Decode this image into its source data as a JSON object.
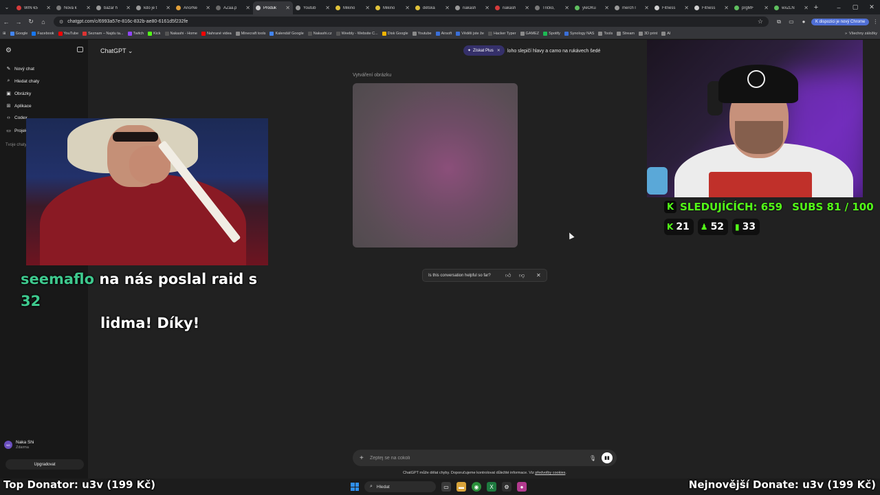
{
  "browser": {
    "tabs": [
      {
        "label": "WIN €5",
        "color": "#d63b3b",
        "active": false
      },
      {
        "label": "Nová k",
        "color": "#7a7a7a",
        "active": false
      },
      {
        "label": "bazar h",
        "color": "#9a9a9a",
        "active": false
      },
      {
        "label": "kdo je t",
        "color": "#9a9a9a",
        "active": false
      },
      {
        "label": "Ano/Ne",
        "color": "#e2a03a",
        "active": false
      },
      {
        "label": "AZaa.p",
        "color": "#6b6b6b",
        "active": false
      },
      {
        "label": "Produk",
        "color": "#cfcfcf",
        "active": true
      },
      {
        "label": "Youtub",
        "color": "#9a9a9a",
        "active": false
      },
      {
        "label": "Mikino",
        "color": "#e0c23a",
        "active": false
      },
      {
        "label": "Mikino",
        "color": "#e0c23a",
        "active": false
      },
      {
        "label": "dětská",
        "color": "#e0c23a",
        "active": false
      },
      {
        "label": "nakash",
        "color": "#9a9a9a",
        "active": false
      },
      {
        "label": "nakash",
        "color": "#d63b3b",
        "active": false
      },
      {
        "label": "Tričko,",
        "color": "#7a7a7a",
        "active": false
      },
      {
        "label": "yleOKu",
        "color": "#5fbf5f",
        "active": false
      },
      {
        "label": "merch l",
        "color": "#9a9a9a",
        "active": false
      },
      {
        "label": "Fitness",
        "color": "#cfcfcf",
        "active": false
      },
      {
        "label": "Fitness",
        "color": "#cfcfcf",
        "active": false
      },
      {
        "label": "prgMF",
        "color": "#5fbf5f",
        "active": false
      },
      {
        "label": "wxZLN",
        "color": "#5fbf5f",
        "active": false
      }
    ],
    "url": "chatgpt.com/c/6993a57e-816c-832b-ae80-6161d5f232fe",
    "promo": "K dispozici je nový Chrome",
    "bookmarks": [
      {
        "label": "Google",
        "color": "#4285f4"
      },
      {
        "label": "Facebook",
        "color": "#1877f2"
      },
      {
        "label": "YouTube",
        "color": "#ff0000"
      },
      {
        "label": "Seznam – Najdu ta...",
        "color": "#d33"
      },
      {
        "label": "Twitch",
        "color": "#9146ff"
      },
      {
        "label": "Kick",
        "color": "#53fc18"
      },
      {
        "label": "Nakashi - Home",
        "color": "#555555"
      },
      {
        "label": "Nahrané videa",
        "color": "#ff0000"
      },
      {
        "label": "Minecraft tools",
        "color": "#8a8a8a"
      },
      {
        "label": "Kalendář Google",
        "color": "#4285f4"
      },
      {
        "label": "Nakashi.cz",
        "color": "#555555"
      },
      {
        "label": "Weebly - Website C...",
        "color": "#555555"
      },
      {
        "label": "Disk Google",
        "color": "#f4b400"
      },
      {
        "label": "Youtube",
        "color": "#8a8a8a"
      },
      {
        "label": "Airsoft",
        "color": "#3a6fd8"
      },
      {
        "label": "Věděli jste že",
        "color": "#3a6fd8"
      },
      {
        "label": "Hacker Typer",
        "color": "#555555"
      },
      {
        "label": "GAMEZ",
        "color": "#8a8a8a"
      },
      {
        "label": "Spotify",
        "color": "#1db954"
      },
      {
        "label": "Synology NAS",
        "color": "#3a6fd8"
      },
      {
        "label": "Tools",
        "color": "#8a8a8a"
      },
      {
        "label": "Stream",
        "color": "#8a8a8a"
      },
      {
        "label": "3D print",
        "color": "#8a8a8a"
      },
      {
        "label": "AI",
        "color": "#8a8a8a"
      }
    ],
    "all_bookmarks": "Všechny záložky"
  },
  "sidebar": {
    "items": [
      {
        "label": "Nový chat",
        "icon": "✎"
      },
      {
        "label": "Hledat chaty",
        "icon": "⌕"
      },
      {
        "label": "Obrázky",
        "icon": "▣"
      },
      {
        "label": "Aplikace",
        "icon": "⊞"
      },
      {
        "label": "Codex",
        "icon": "‹›"
      },
      {
        "label": "Projekty",
        "icon": "▭"
      }
    ],
    "section_label": "Tvoje chaty",
    "user": {
      "initials": "NS",
      "name": "Naka Shi",
      "plan": "Zdarma"
    },
    "upgrade_label": "Upgradovat"
  },
  "chat": {
    "model": "ChatGPT",
    "plus_label": "Získat Plus",
    "prompt_snippet": "loho slepičí hlavy a camo na rukávech šedé",
    "image_label": "Vytváření obrázku",
    "feedback_question": "Is this conversation helpful so far?",
    "composer_placeholder": "Zeptej se na cokoli",
    "disclaimer_text": "ChatGPT může dělat chyby. Doporučujeme kontrolovat důležité informace. Viz ",
    "disclaimer_link": "předvolby cookies",
    "disclaimer_end": "."
  },
  "stream": {
    "raid_user": "seemaflo",
    "raid_mid": "na nás poslal raid s",
    "raid_count": "32",
    "raid_end": "lidma! Díky!",
    "followers_label": "SLEDUJÍCÍCH: 659",
    "subs_label": "SUBS 81 / 100",
    "stat_kick": "21",
    "stat_users": "52",
    "stat_bars": "33",
    "top_donator": "Top Donator: u3v (199 Kč)",
    "latest_donate": "Nejnovější Donate: u3v (199 Kč)"
  },
  "taskbar": {
    "search_label": "Hledat"
  },
  "colors": {
    "kick_green": "#53fc18",
    "raid_highlight": "#3ec98e",
    "accent": "#4f6fd6"
  }
}
